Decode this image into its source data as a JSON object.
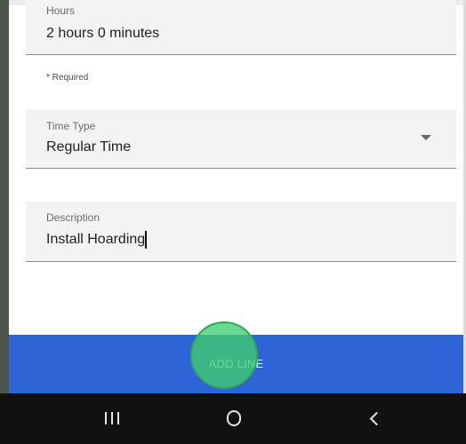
{
  "hours_field": {
    "label": "Hours",
    "value": "2 hours 0 minutes"
  },
  "required_note": "* Required",
  "time_type_field": {
    "label": "Time Type",
    "value": "Regular Time",
    "icon": "dropdown-arrow-icon"
  },
  "description_field": {
    "label": "Description",
    "value": "Install Hoarding"
  },
  "add_line_button": {
    "label": "ADD LINE"
  },
  "nav_bar": {
    "icons": [
      "recent-apps-icon",
      "home-icon",
      "back-icon"
    ]
  },
  "colors": {
    "primary_button": "#2e64d6",
    "touch_indicator": "#40cd6e",
    "nav_bar": "#111111",
    "field_background": "#f3f3f3"
  }
}
